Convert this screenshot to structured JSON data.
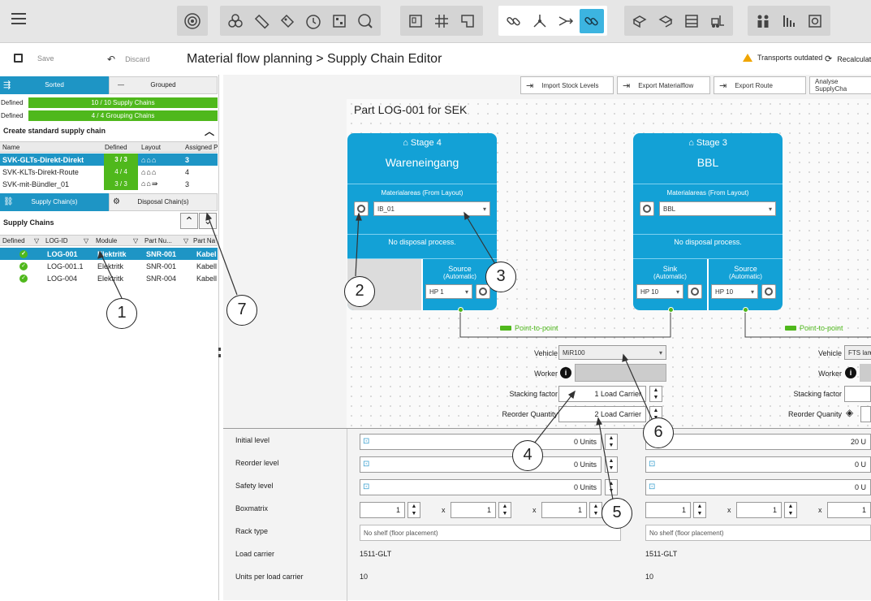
{
  "toolbar": {
    "menu_icon": "hamburger-icon"
  },
  "titlebar": {
    "save": "Save",
    "discard": "Discard",
    "breadcrumb": "Material flow planning > Supply Chain Editor",
    "warning": "Transports outdated",
    "recalc": "Recalculat"
  },
  "left": {
    "tab_sorted": "Sorted",
    "tab_grouped": "Grouped",
    "defined1_label": "Defined",
    "defined1_value": "10 / 10 Supply Chains",
    "defined2_label": "Defined",
    "defined2_value": "4 / 4 Grouping Chains",
    "std_title": "Create standard supply chain",
    "std_cols": [
      "Name",
      "Defined",
      "Layout",
      "Assigned P"
    ],
    "std_rows": [
      {
        "name": "SVK-GLTs-Direkt-Direkt",
        "defined": "3 / 3",
        "assigned": "3"
      },
      {
        "name": "SVK-KLTs-Direkt-Route",
        "defined": "4 / 4",
        "assigned": "4"
      },
      {
        "name": "SVK-mit-Bündler_01",
        "defined": "3 / 3",
        "assigned": "3"
      }
    ],
    "tab_supply": "Supply Chain(s)",
    "tab_disposal": "Disposal Chain(s)",
    "sc_title": "Supply Chains",
    "sc_cols": [
      "Defined",
      "LOG-ID",
      "Module",
      "Part Nu...",
      "Part Na"
    ],
    "sc_rows": [
      {
        "id": "LOG-001",
        "module": "Elektritk",
        "part": "SNR-001",
        "name": "Kabel"
      },
      {
        "id": "LOG-001.1",
        "module": "Elektritk",
        "part": "SNR-001",
        "name": "Kabell"
      },
      {
        "id": "LOG-004",
        "module": "Elektritk",
        "part": "SNR-004",
        "name": "Kabell"
      }
    ]
  },
  "right": {
    "actions": [
      "Import Stock Levels",
      "Export Materialflow",
      "Export Route",
      "Analyse SupplyCha"
    ],
    "part_title": "Part LOG-001 for SEK",
    "stage4": {
      "label": "Stage 4",
      "name": "Wareneingang",
      "areas_label": "Materialareas (From Layout)",
      "area_value": "IB_01",
      "disposal": "No disposal process.",
      "source_label": "Source",
      "source_sub": "(Automatic)",
      "source_hp": "HP 1"
    },
    "stage3": {
      "label": "Stage 3",
      "name": "BBL",
      "areas_label": "Materialareas (From Layout)",
      "area_value": "BBL",
      "disposal": "No disposal process.",
      "sink_label": "Sink",
      "sink_sub": "(Automatic)",
      "sink_hp": "HP 10",
      "source_label": "Source",
      "source_sub": "(Automatic)",
      "source_hp": "HP 10"
    },
    "transport1": {
      "type": "Point-to-point",
      "vehicle_label": "Vehicle",
      "vehicle_value": "MiR100",
      "worker_label": "Worker",
      "stacking_label": "Stacking factor",
      "stacking_value": "1 Load Carrier",
      "reorder_label": "Reorder Quantity",
      "reorder_value": "2 Load Carrier"
    },
    "transport2": {
      "type": "Point-to-point",
      "vehicle_label": "Vehicle",
      "vehicle_value": "FTS lang",
      "worker_label": "Worker",
      "stacking_label": "Stacking factor",
      "reorder_label": "Reorder Quanity"
    },
    "lower": {
      "labels": [
        "Initial level",
        "Reorder level",
        "Safety level",
        "Boxmatrix",
        "Rack type",
        "Load carrier",
        "Units per load carrier"
      ],
      "col1": {
        "initial": "0 Units",
        "reorder": "0 Units",
        "safety": "0 Units",
        "box": [
          "1",
          "1",
          "1"
        ],
        "rack": "No shelf (floor placement)",
        "carrier": "1511-GLT",
        "units": "10"
      },
      "col2": {
        "initial": "20 U",
        "reorder": "0 U",
        "safety": "0 U",
        "box": [
          "1",
          "1",
          "1"
        ],
        "rack": "No shelf (floor placement)",
        "carrier": "1511-GLT",
        "units": "10"
      },
      "x": "x"
    }
  },
  "callouts": [
    "1",
    "2",
    "3",
    "4",
    "5",
    "6",
    "7"
  ]
}
